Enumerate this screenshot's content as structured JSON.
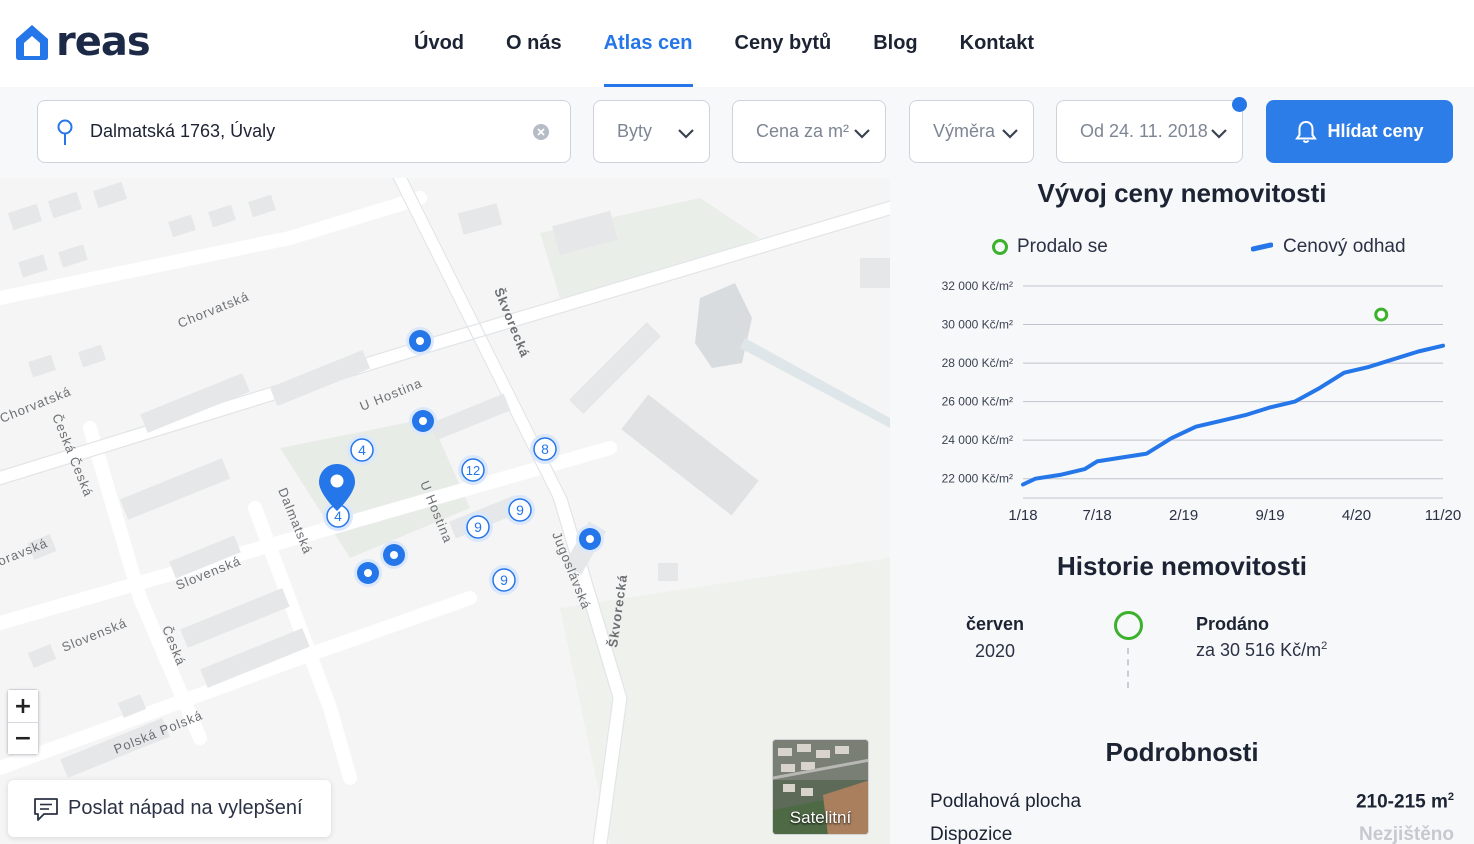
{
  "brand": {
    "name": "reas",
    "accent": "#2576e8"
  },
  "nav": {
    "items": [
      {
        "label": "Úvod",
        "active": false
      },
      {
        "label": "O nás",
        "active": false
      },
      {
        "label": "Atlas cen",
        "active": true
      },
      {
        "label": "Ceny bytů",
        "active": false
      },
      {
        "label": "Blog",
        "active": false
      },
      {
        "label": "Kontakt",
        "active": false
      }
    ]
  },
  "filters": {
    "address": "Dalmatská 1763, Úvaly",
    "type": "Byty",
    "price_per_m2": "Cena za m²",
    "area": "Výměra",
    "from_date": "Od 24. 11. 2018",
    "watch_button": "Hlídat ceny"
  },
  "map": {
    "streets": [
      "Chorvatská",
      "Chorvatská",
      "Česká Česká",
      "U Hostina",
      "U Hostina",
      "Škvorecká",
      "Škvorecká",
      "Dalmatská",
      "Slovenská",
      "Slovenská",
      "Česká",
      "Polská Polská",
      "Jugoslávská",
      "oravská"
    ],
    "clusters": [
      "4",
      "12",
      "8",
      "9",
      "9",
      "9",
      "4"
    ],
    "zoom_in": "+",
    "zoom_out": "−",
    "feedback": "Poslat nápad na vylepšení",
    "satellite": "Satelitní"
  },
  "price_chart": {
    "heading": "Vývoj ceny nemovitosti",
    "legend_sold": "Prodalo se",
    "legend_estimate": "Cenový odhad"
  },
  "chart_data": {
    "type": "line",
    "title": "Vývoj ceny nemovitosti",
    "x_ticks": [
      "1/18",
      "7/18",
      "2/19",
      "9/19",
      "4/20",
      "11/20"
    ],
    "y_ticks": [
      "22 000 Kč/m²",
      "24 000 Kč/m²",
      "26 000 Kč/m²",
      "28 000 Kč/m²",
      "30 000 Kč/m²",
      "32 000 Kč/m²"
    ],
    "ylim": [
      21000,
      32000
    ],
    "series": [
      {
        "name": "Cenový odhad",
        "color": "#2576e8",
        "x": [
          "2018-01",
          "2018-02",
          "2018-04",
          "2018-06",
          "2018-07",
          "2018-09",
          "2018-11",
          "2019-01",
          "2019-03",
          "2019-05",
          "2019-07",
          "2019-09",
          "2019-11",
          "2020-01",
          "2020-03",
          "2020-05",
          "2020-07",
          "2020-09",
          "2020-11"
        ],
        "values": [
          21700,
          22000,
          22200,
          22500,
          22900,
          23100,
          23300,
          24100,
          24700,
          25000,
          25300,
          25700,
          26000,
          26700,
          27500,
          27800,
          28200,
          28600,
          28900
        ]
      },
      {
        "name": "Prodalo se",
        "color": "#3bb12c",
        "x": [
          "2020-06"
        ],
        "values": [
          30516
        ]
      }
    ],
    "grid": true,
    "legend": "top"
  },
  "history": {
    "heading": "Historie nemovitosti",
    "month": "červen",
    "year": "2020",
    "status": "Prodáno",
    "price_text": "za 30 516 Kč/m",
    "price_sup": "2"
  },
  "details": {
    "heading": "Podrobnosti",
    "rows": [
      {
        "label": "Podlahová plocha",
        "value": "210-215 m",
        "sup": "2"
      },
      {
        "label": "Dispozice",
        "value": "Nezjištěno"
      }
    ]
  }
}
